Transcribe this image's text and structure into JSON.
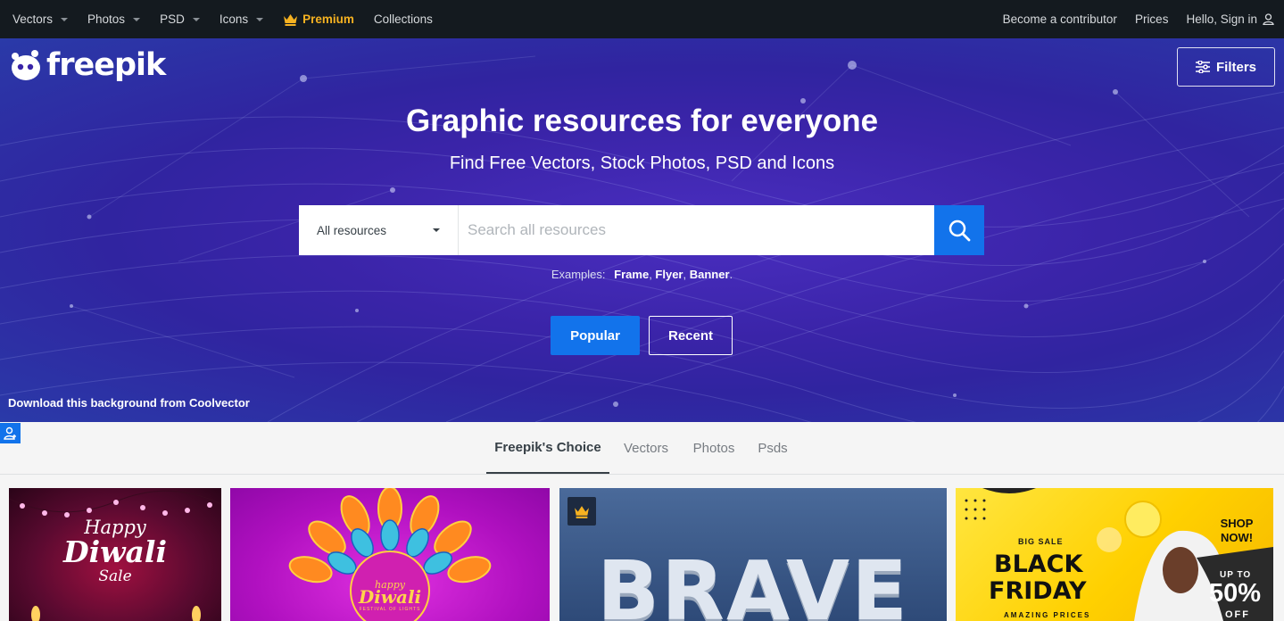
{
  "topnav": {
    "items": [
      {
        "label": "Vectors"
      },
      {
        "label": "Photos"
      },
      {
        "label": "PSD"
      },
      {
        "label": "Icons"
      }
    ],
    "premium_label": "Premium",
    "collections_label": "Collections",
    "contributor_label": "Become a contributor",
    "prices_label": "Prices",
    "signin_label": "Hello, Sign in"
  },
  "hero": {
    "logo_text": "freepik",
    "filters_label": "Filters",
    "title": "Graphic resources for everyone",
    "subtitle": "Find Free Vectors, Stock Photos, PSD and Icons",
    "search": {
      "category": "All resources",
      "placeholder": "Search all resources",
      "value": ""
    },
    "examples_label": "Examples:",
    "examples": [
      "Frame",
      "Flyer",
      "Banner"
    ],
    "popular_label": "Popular",
    "recent_label": "Recent",
    "credit": "Download this background from Coolvector"
  },
  "tabs": [
    {
      "label": "Freepik's Choice",
      "active": true
    },
    {
      "label": "Vectors",
      "active": false
    },
    {
      "label": "Photos",
      "active": false
    },
    {
      "label": "Psds",
      "active": false
    }
  ],
  "thumbnails": {
    "t1": {
      "happy": "Happy",
      "diwali": "Diwali",
      "sale": "Sale"
    },
    "t2": {
      "happy": "happy",
      "diwali": "Diwali",
      "festival": "FESTIVAL OF LIGHTS"
    },
    "t3": {
      "word": "BRAVE",
      "premium_icon": "crown-icon"
    },
    "t4": {
      "big_sale": "BIG SALE",
      "black": "BLACK",
      "friday": "FRIDAY",
      "amazing": "AMAZING PRICES",
      "shop_now": "SHOP NOW!",
      "up_to": "UP TO",
      "percent": "50%",
      "off": "OFF"
    }
  },
  "colors": {
    "nav_bg": "#141a1f",
    "accent": "#1273eb",
    "premium": "#f6b221"
  }
}
